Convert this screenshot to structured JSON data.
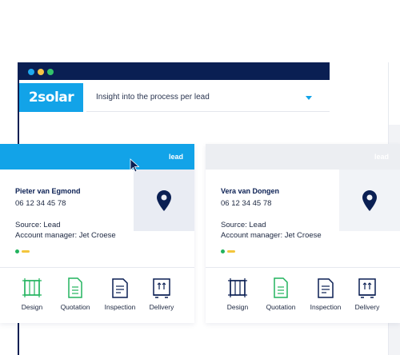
{
  "app": {
    "logo": "2solar",
    "dropdown_label": "Insight into the process per lead"
  },
  "colors": {
    "navy": "#0a1f53",
    "accent": "#12a3e8",
    "green": "#22b35e",
    "yellow": "#f3c53c"
  },
  "cards": [
    {
      "tag": "lead",
      "name": "Pieter van Egmond",
      "phone": "06 12 34 45 78",
      "source": "Source: Lead",
      "manager": "Account manager: Jet Croese",
      "active": true,
      "steps": [
        {
          "label": "Design",
          "icon": "design-icon"
        },
        {
          "label": "Quotation",
          "icon": "quotation-icon"
        },
        {
          "label": "Inspection",
          "icon": "inspection-icon"
        },
        {
          "label": "Delivery",
          "icon": "delivery-icon"
        }
      ]
    },
    {
      "tag": "lead",
      "name": "Vera van Dongen",
      "phone": "06 12 34 45 78",
      "source": "Source: Lead",
      "manager": "Account manager: Jet Croese",
      "active": false,
      "steps": [
        {
          "label": "Design",
          "icon": "design-icon"
        },
        {
          "label": "Quotation",
          "icon": "quotation-icon"
        },
        {
          "label": "Inspection",
          "icon": "inspection-icon"
        },
        {
          "label": "Delivery",
          "icon": "delivery-icon"
        }
      ]
    }
  ]
}
